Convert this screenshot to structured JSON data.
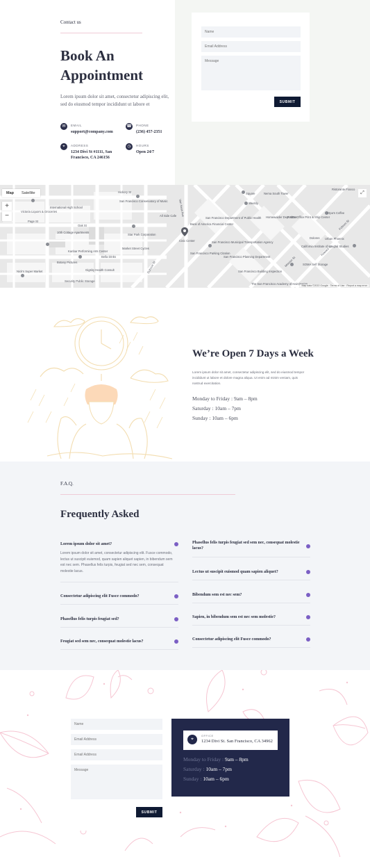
{
  "colors": {
    "accent_navy": "#0f1a33",
    "card_navy": "#22284a",
    "faq_dot": "#7b5fc4",
    "line_pink": "#efcbd6"
  },
  "hero": {
    "kicker": "Contact us",
    "title_line1": "Book An",
    "title_line2": "Appointment",
    "description": "Lorem ipsum dolor sit amet, consectetur adipiscing elit, sed do eiusmod tempor incididunt ut labore et",
    "info": [
      {
        "icon": "mail-icon",
        "label": "EMAIL",
        "value": "support@company.com"
      },
      {
        "icon": "phone-icon",
        "label": "PHONE",
        "value": "(236) 457-2351"
      },
      {
        "icon": "location-icon",
        "label": "ADDRESS",
        "value": "1234 Divi St #1111, San Francisco, CA 246156"
      },
      {
        "icon": "clock-icon",
        "label": "HOURS",
        "value": "Open 24/7"
      }
    ],
    "form": {
      "name_placeholder": "Name",
      "email_placeholder": "Email Address",
      "message_placeholder": "Message",
      "submit_label": "SUBMIT"
    }
  },
  "map": {
    "type_map": "Map",
    "type_satellite": "Satellite",
    "zoom_in": "+",
    "zoom_out": "−",
    "attribution": "Map data ©2022 Google · Terms of Use · Report a map error",
    "labels": [
      "Hickory St",
      "San Francisco Conservatory of Music",
      "Square",
      "Nema South Tower",
      "Ristorante Franco",
      "Victoria Liquors & Groceries",
      "International High School",
      "Weebly",
      "Homewalder Dept Store",
      "FedEx Office Print & Ship Center",
      "Oak St",
      "All Side Cafe",
      "Bank of America Financial Center",
      "Opa's Coffee",
      "10th Cottage Apartments",
      "San Francisco Department of Public Health",
      "Page St",
      "Civic Center",
      "Dolores",
      "Urban Phoenix",
      "Kanbar Performing Arts Center",
      "Star Park Corporation",
      "San Francisco Municipal Transportation Agency",
      "California Institute of Integral Studies",
      "Market Street Cycles",
      "San Francisco Parking Citation",
      "Botany Pictures",
      "Bella Dinks",
      "San Francisco Planning Department",
      "SOMA Self Storage",
      "Nick's Super Market",
      "Gigsby Health Consult",
      "San Francisco Building Inspection",
      "Security Public Storage",
      "The San Francisco Academy of Hair Design",
      "Van Ness Ave",
      "Mission St",
      "Howard St",
      "Folsom St",
      "Duboce St"
    ]
  },
  "open": {
    "title": "We’re Open 7 Days a Week",
    "description": "Lorem ipsum dolor sit amet, consectetur adipiscing elit, sed do eiusmod tempor incididunt ut labore et dolore magna aliqua. Ut enim ad minim veniam, quis nostrud exercitation.",
    "hours": [
      "Monday to Friday : 9am – 8pm",
      "Saturday : 10am – 7pm",
      "Sunday : 10am – 6pm"
    ]
  },
  "faq": {
    "kicker": "F.A.Q.",
    "title": "Frequently Asked",
    "left": [
      {
        "q": "Lorem ipsum dolor sit amet?",
        "a": "Lorem ipsum dolor sit amet, consectetur adipiscing elit. Fusce commodo, lectus ut suscipit euismod, quam sapien aliquet sapien, in bibendum sem est nec sem. Phasellus felis turpis, feugiat sed nec sem, consequat molestie lacus."
      },
      {
        "q": "Consectetur adipiscing elit Fusce commodo?"
      },
      {
        "q": "Phasellus felis turpis feugiat sed?"
      },
      {
        "q": "Feugiat sed sem nec, consequat molestie lacus?"
      }
    ],
    "right": [
      {
        "q": "Phasellus felis turpis feugiat sed sem nec, consequat molestie lacus?"
      },
      {
        "q": "Lectus ut suscipit euismod quam sapien aliquet?"
      },
      {
        "q": "Bibendum sem est nec sem?"
      },
      {
        "q": "Sapien, in bibendum sem est nec sem molestie?"
      },
      {
        "q": "Consectetur adipiscing elit Fusce commodo?"
      }
    ]
  },
  "contact": {
    "form": {
      "name_placeholder": "Name",
      "email_placeholder": "Email Address",
      "email2_placeholder": "Email Address",
      "message_placeholder": "Message",
      "submit_label": "SUBMIT"
    },
    "office": {
      "label": "OFFICE",
      "address": "1234 Divi St. San Francisco, CA 34962",
      "hours": [
        {
          "day": "Monday to Friday : ",
          "time": "9am – 8pm"
        },
        {
          "day": "Saturday : ",
          "time": "10am – 7pm"
        },
        {
          "day": "Sunday : ",
          "time": "10am – 6pm"
        }
      ]
    }
  }
}
